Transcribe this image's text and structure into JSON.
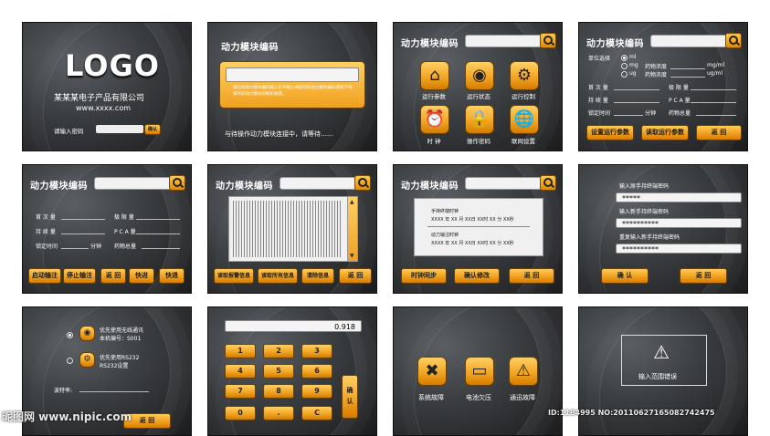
{
  "p1": {
    "logo": "LOGO",
    "company": "某某某电子产品有限公司",
    "url": "www.xxxx.com",
    "pw_label": "请输入密码",
    "confirm": "确认"
  },
  "p2": {
    "title": "动力模块编码",
    "notice": "请启动动力模块编码输入栏中输入待操作的动力模块编码或按下待操作的动力模块的联机按键。",
    "waiting": "与待操作动力模块连接中，请等待……"
  },
  "p3": {
    "title": "动力模块编码",
    "icons": [
      {
        "label": "运行参数",
        "icon": "home-icon"
      },
      {
        "label": "运行状态",
        "icon": "rss-icon"
      },
      {
        "label": "运行控制",
        "icon": "gear-icon"
      },
      {
        "label": "时 钟",
        "icon": "clock-icon"
      },
      {
        "label": "操作密码",
        "icon": "lock-icon"
      },
      {
        "label": "联网设置",
        "icon": "globe-icon"
      }
    ]
  },
  "p4": {
    "title": "动力模块编码",
    "unit_label": "单位选择",
    "units": [
      "ml",
      "mg",
      "ug"
    ],
    "conc1": "药物浓度",
    "conc1_unit": "mg/ml",
    "conc2": "药物浓度",
    "conc2_unit": "ug/ml",
    "first_dose": "首 次 量",
    "limit": "极 限 量",
    "maint": "持 续 量",
    "pca": "P C A 量",
    "lock_time": "锁定时间",
    "minutes": "分钟",
    "total": "药物总量",
    "btn_set": "设置运行参数",
    "btn_read": "读取运行参数",
    "btn_back": "返 回"
  },
  "p5": {
    "title": "动力模块编码",
    "first_dose": "首 次 量",
    "limit": "极 限 量",
    "maint": "持 续 量",
    "pca": "P C A 量",
    "lock_time": "锁定时间",
    "minutes": "分钟",
    "total": "药物总量",
    "buttons": [
      "启动输注",
      "停止输注",
      "返 回",
      "快进",
      "快退"
    ]
  },
  "p6": {
    "title": "动力模块编码",
    "buttons": [
      "读取报警信息",
      "读取所有信息",
      "清除信息",
      "返 回"
    ]
  },
  "p7": {
    "title": "动力模块编码",
    "handheld_label": "手持终端时钟",
    "handheld_value": "XXXX 年 XX 月 XX日 XX时 XX 分 XX秒",
    "module_label": "动力输注时钟",
    "module_value": "XXXX 年 XX 月 XX日 XX时 XX 分 XX秒",
    "buttons": [
      "时钟同步",
      "确认修改",
      "返 回"
    ]
  },
  "p8": {
    "old_label": "输入原手持终端密码",
    "old_value": "*****",
    "new_label": "输入新手持终端密码",
    "new_value": "**********",
    "repeat_label": "重复输入新手持终端密码",
    "repeat_value": "**********",
    "btn_ok": "确 认",
    "btn_back": "返 回"
  },
  "p9": {
    "opt1_line1": "优先使用无线通讯",
    "opt1_line2": "本机编号：S001",
    "opt2_line1": "优先使用RS232",
    "opt2_line2": "RS232设置",
    "baud_label": "波特率:",
    "btn_back": "返 回"
  },
  "p10": {
    "display": "0.918",
    "keys": [
      "1",
      "2",
      "3",
      "4",
      "5",
      "6",
      "7",
      "8",
      "9",
      "0",
      ".",
      "C"
    ],
    "confirm": "确 认"
  },
  "p11": {
    "items": [
      {
        "label": "系统故障",
        "icon": "tools-icon"
      },
      {
        "label": "电池欠压",
        "icon": "battery-icon"
      },
      {
        "label": "通迅故障",
        "icon": "warning-icon"
      }
    ]
  },
  "p12": {
    "error": "输入范围错误"
  },
  "watermark": {
    "left": "昵图网 www.nipic.com",
    "right": "ID:1184995 NO:20110627165082742475"
  }
}
